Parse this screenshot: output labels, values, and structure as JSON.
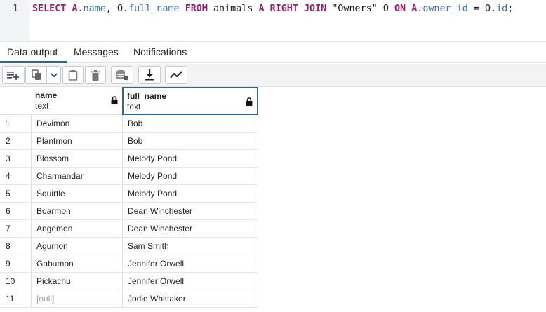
{
  "editor": {
    "line_number": "1",
    "query_tokens": [
      {
        "t": "SELECT",
        "c": "kw"
      },
      {
        "t": " ",
        "c": ""
      },
      {
        "t": "A",
        "c": "kw"
      },
      {
        "t": ".",
        "c": ""
      },
      {
        "t": "name",
        "c": "ident"
      },
      {
        "t": ", ",
        "c": ""
      },
      {
        "t": "O",
        "c": ""
      },
      {
        "t": ".",
        "c": ""
      },
      {
        "t": "full_name",
        "c": "ident"
      },
      {
        "t": " ",
        "c": ""
      },
      {
        "t": "FROM",
        "c": "kw"
      },
      {
        "t": " animals ",
        "c": ""
      },
      {
        "t": "A",
        "c": "kw"
      },
      {
        "t": " ",
        "c": ""
      },
      {
        "t": "RIGHT JOIN",
        "c": "kw"
      },
      {
        "t": " ",
        "c": ""
      },
      {
        "t": "\"Owners\"",
        "c": "str"
      },
      {
        "t": " O ",
        "c": ""
      },
      {
        "t": "ON",
        "c": "kw"
      },
      {
        "t": " ",
        "c": ""
      },
      {
        "t": "A",
        "c": "kw"
      },
      {
        "t": ".",
        "c": ""
      },
      {
        "t": "owner_id",
        "c": "ident"
      },
      {
        "t": " = O.",
        "c": ""
      },
      {
        "t": "id",
        "c": "ident"
      },
      {
        "t": ";",
        "c": ""
      }
    ]
  },
  "tabs": [
    {
      "label": "Data output",
      "active": true
    },
    {
      "label": "Messages",
      "active": false
    },
    {
      "label": "Notifications",
      "active": false
    }
  ],
  "toolbar": {
    "buttons": [
      "add-row-icon",
      "copy-icon",
      "chevron-down-icon",
      "paste-icon",
      "delete-icon",
      "save-data-icon",
      "download-icon",
      "graph-icon"
    ]
  },
  "grid": {
    "columns": [
      {
        "name": "name",
        "type": "text",
        "locked": true
      },
      {
        "name": "full_name",
        "type": "text",
        "locked": true,
        "selected": true
      }
    ],
    "rows": [
      {
        "n": "1",
        "name": "Devimon",
        "full_name": "Bob"
      },
      {
        "n": "2",
        "name": "Plantmon",
        "full_name": "Bob"
      },
      {
        "n": "3",
        "name": "Blossom",
        "full_name": "Melody Pond"
      },
      {
        "n": "4",
        "name": "Charmandar",
        "full_name": "Melody Pond"
      },
      {
        "n": "5",
        "name": "Squirtle",
        "full_name": "Melody Pond"
      },
      {
        "n": "6",
        "name": "Boarmon",
        "full_name": "Dean Winchester"
      },
      {
        "n": "7",
        "name": "Angemon",
        "full_name": "Dean Winchester"
      },
      {
        "n": "8",
        "name": "Agumon",
        "full_name": "Sam Smith"
      },
      {
        "n": "9",
        "name": "Gabumon",
        "full_name": "Jennifer Orwell"
      },
      {
        "n": "10",
        "name": "Pickachu",
        "full_name": "Jennifer Orwell"
      },
      {
        "n": "11",
        "name": "[null]",
        "name_is_null": true,
        "full_name": "Jodie Whittaker"
      }
    ]
  }
}
